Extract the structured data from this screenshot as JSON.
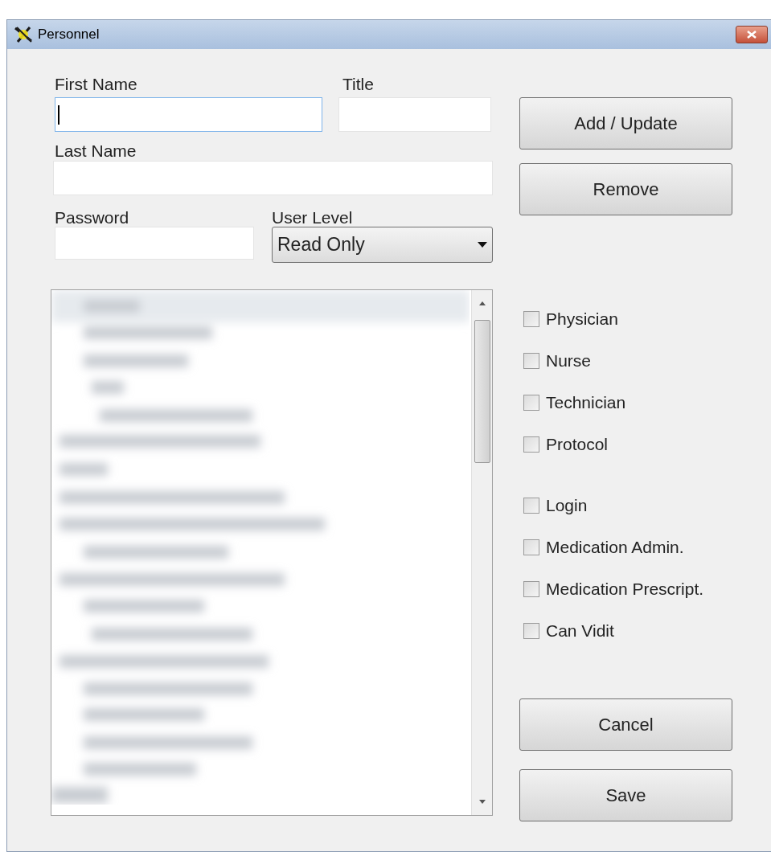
{
  "window": {
    "title": "Personnel"
  },
  "fields": {
    "first_name": {
      "label": "First Name",
      "focused": true
    },
    "title": {
      "label": "Title"
    },
    "last_name": {
      "label": "Last Name"
    },
    "password": {
      "label": "Password"
    },
    "user_level": {
      "label": "User Level",
      "value": "Read Only"
    }
  },
  "buttons_top": [
    "Add / Update",
    "Remove"
  ],
  "role_checkboxes": [
    {
      "label": "Physician",
      "checked": false
    },
    {
      "label": "Nurse",
      "checked": false
    },
    {
      "label": "Technician",
      "checked": false
    },
    {
      "label": "Protocol",
      "checked": false
    }
  ],
  "permission_checkboxes": [
    {
      "label": "Login",
      "checked": false
    },
    {
      "label": "Medication Admin.",
      "checked": false
    },
    {
      "label": "Medication Prescript.",
      "checked": false
    },
    {
      "label": "Can Vidit",
      "checked": false
    }
  ],
  "buttons_bottom": [
    "Cancel",
    "Save"
  ]
}
